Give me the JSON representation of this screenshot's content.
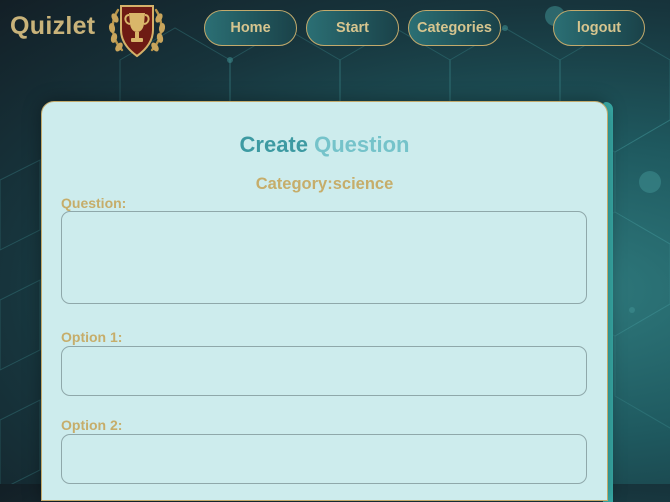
{
  "brand": {
    "name": "Quizlet",
    "logo_icon": "trophy-shield-laurel-icon"
  },
  "nav": {
    "home_label": "Home",
    "start_label": "Start",
    "categories_label": "Categories",
    "logout_label": "logout"
  },
  "form": {
    "title_word1": "Create",
    "title_word2": "Question",
    "category_text": "Category:science",
    "question_label": "Question:",
    "question_value": "",
    "option1_label": "Option 1:",
    "option1_value": "",
    "option2_label": "Option 2:",
    "option2_value": ""
  },
  "colors": {
    "gold": "#c6ad6a",
    "card_background": "#cdeced",
    "title_teal": "#3d9aa2",
    "title_light_teal": "#75c3ca",
    "background_dark": "#131f26",
    "background_teal": "#2f7a7d"
  }
}
